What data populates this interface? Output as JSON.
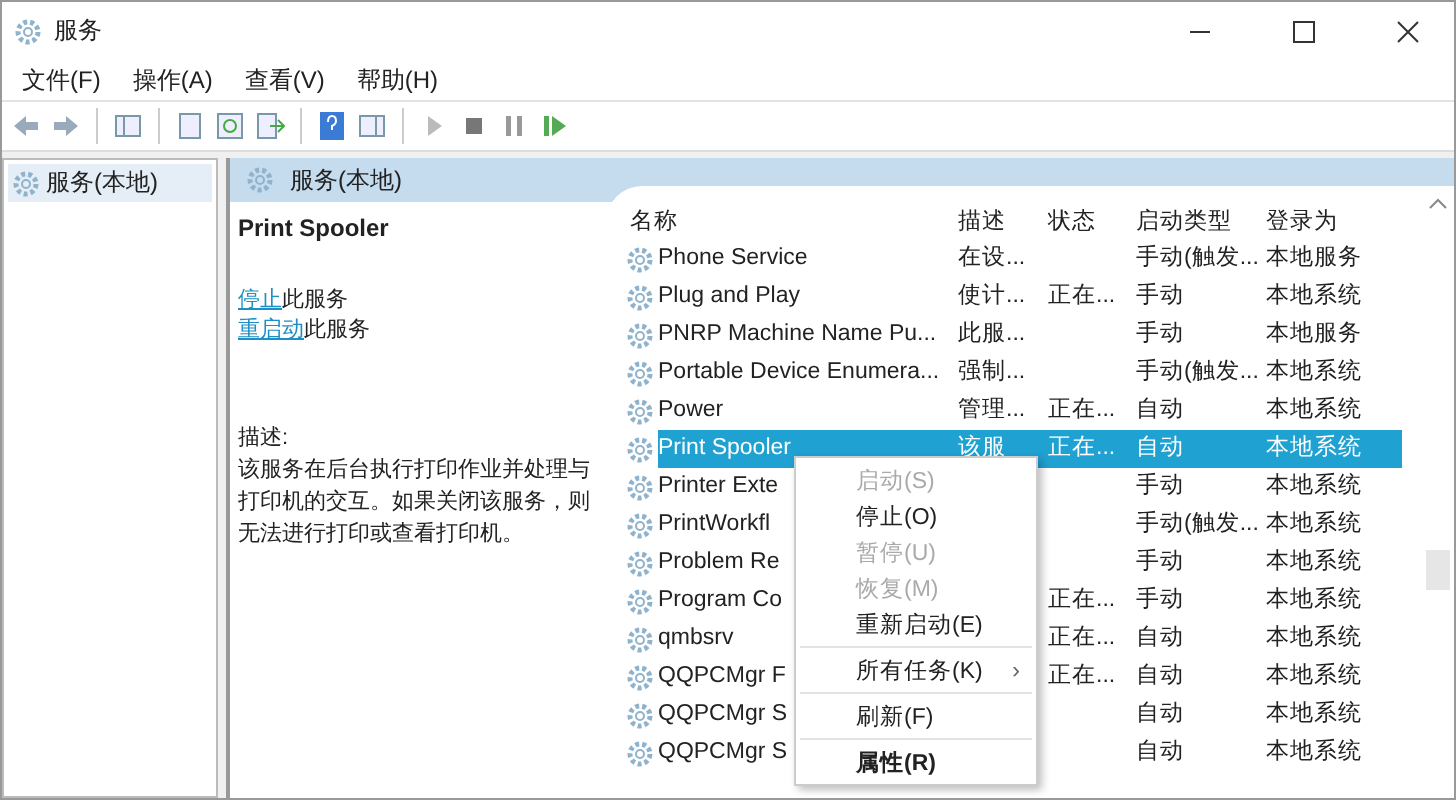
{
  "window": {
    "title": "服务"
  },
  "menu_bar": [
    "文件(F)",
    "操作(A)",
    "查看(V)",
    "帮助(H)"
  ],
  "tree": {
    "items": [
      {
        "label": "服务(本地)",
        "selected": true
      }
    ]
  },
  "pane_header": "服务(本地)",
  "details": {
    "service_name": "Print Spooler",
    "actions": [
      {
        "link": "停止",
        "text": "此服务"
      },
      {
        "link": "重启动",
        "text": "此服务"
      }
    ],
    "description_label": "描述:",
    "description": "该服务在后台执行打印作业并处理与打印机的交互。如果关闭该服务，则无法进行打印或查看打印机。"
  },
  "table": {
    "columns": [
      "名称",
      "描述",
      "状态",
      "启动类型",
      "登录为"
    ],
    "rows": [
      {
        "name": "Phone Service",
        "description": "在设...",
        "status": "",
        "startup": "手动(触发...",
        "logon": "本地服务",
        "selected": false
      },
      {
        "name": "Plug and Play",
        "description": "使计...",
        "status": "正在...",
        "startup": "手动",
        "logon": "本地系统",
        "selected": false
      },
      {
        "name": "PNRP Machine Name Pu...",
        "description": "此服...",
        "status": "",
        "startup": "手动",
        "logon": "本地服务",
        "selected": false
      },
      {
        "name": "Portable Device Enumera...",
        "description": "强制...",
        "status": "",
        "startup": "手动(触发...",
        "logon": "本地系统",
        "selected": false
      },
      {
        "name": "Power",
        "description": "管理...",
        "status": "正在...",
        "startup": "自动",
        "logon": "本地系统",
        "selected": false
      },
      {
        "name": "Print Spooler",
        "description": "该服",
        "status": "正在...",
        "startup": "自动",
        "logon": "本地系统",
        "selected": true
      },
      {
        "name": "Printer Exte",
        "description": "",
        "status": "",
        "startup": "手动",
        "logon": "本地系统",
        "selected": false
      },
      {
        "name": "PrintWorkfl",
        "description": "",
        "status": "",
        "startup": "手动(触发...",
        "logon": "本地系统",
        "selected": false
      },
      {
        "name": "Problem Re",
        "description": "",
        "status": "",
        "startup": "手动",
        "logon": "本地系统",
        "selected": false
      },
      {
        "name": "Program Co",
        "description": "",
        "status": "正在...",
        "startup": "手动",
        "logon": "本地系统",
        "selected": false
      },
      {
        "name": "qmbsrv",
        "description": "",
        "status": "正在...",
        "startup": "自动",
        "logon": "本地系统",
        "selected": false
      },
      {
        "name": "QQPCMgr F",
        "description": "",
        "status": "正在...",
        "startup": "自动",
        "logon": "本地系统",
        "selected": false
      },
      {
        "name": "QQPCMgr S",
        "description": "",
        "status": "",
        "startup": "自动",
        "logon": "本地系统",
        "selected": false
      },
      {
        "name": "QQPCMgr S",
        "description": "",
        "status": "",
        "startup": "自动",
        "logon": "本地系统",
        "selected": false
      }
    ]
  },
  "context_menu": [
    {
      "kind": "item",
      "label": "启动(S)",
      "disabled": true
    },
    {
      "kind": "item",
      "label": "停止(O)",
      "disabled": false
    },
    {
      "kind": "item",
      "label": "暂停(U)",
      "disabled": true
    },
    {
      "kind": "item",
      "label": "恢复(M)",
      "disabled": true
    },
    {
      "kind": "item",
      "label": "重新启动(E)",
      "disabled": false
    },
    {
      "kind": "separator"
    },
    {
      "kind": "submenu",
      "label": "所有任务(K)",
      "arrow": "›",
      "disabled": false
    },
    {
      "kind": "separator"
    },
    {
      "kind": "item",
      "label": "刷新(F)",
      "disabled": false
    },
    {
      "kind": "separator"
    },
    {
      "kind": "item",
      "label": "属性(R)",
      "disabled": false
    }
  ]
}
